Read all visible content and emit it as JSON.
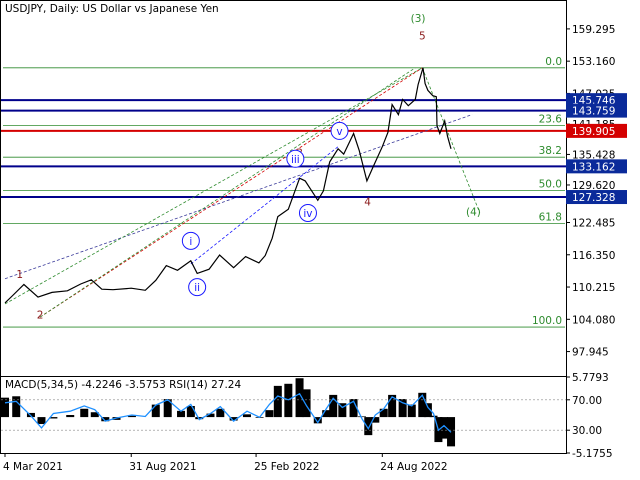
{
  "chart_data": {
    "type": "line",
    "title": "USDJPY, Daily:  US Dollar vs Japanese Yen",
    "colors": {
      "price": "#000000",
      "fib": "#2e8b2e",
      "level_blue": "#00008b",
      "level_red": "#d40000",
      "label_bg_blue": "#0a2a9a",
      "label_bg_red": "#d40000",
      "wave_brown": "#8b1a1a",
      "wave_blue": "#1a1aff",
      "wave_green": "#2e8b2e",
      "grid": "#c8c8c8",
      "macd_hist": "#000000",
      "macd_signal": "#1e90ff",
      "rsi_line": "#1e90ff"
    },
    "price_axis": {
      "ylim": [
        93.3,
        164.6
      ],
      "ticks": [
        "159.295",
        "153.160",
        "147.025",
        "141.185",
        "135.428",
        "129.620",
        "122.485",
        "116.350",
        "110.215",
        "104.080",
        "97.945"
      ]
    },
    "x_axis": {
      "ticks": [
        "4 Mar 2021",
        "31 Aug 2021",
        "25 Feb 2022",
        "24 Aug 2022"
      ],
      "range": [
        "2021-03-04",
        "2022-10-31"
      ]
    },
    "price_series": [
      [
        "2021-03-04",
        107.2
      ],
      [
        "2021-03-15",
        108.6
      ],
      [
        "2021-03-31",
        110.7
      ],
      [
        "2021-04-20",
        108.3
      ],
      [
        "2021-05-10",
        109.2
      ],
      [
        "2021-06-01",
        109.5
      ],
      [
        "2021-06-20",
        110.8
      ],
      [
        "2021-07-05",
        111.6
      ],
      [
        "2021-07-20",
        109.8
      ],
      [
        "2021-08-05",
        109.7
      ],
      [
        "2021-08-31",
        110.0
      ],
      [
        "2021-09-20",
        109.6
      ],
      [
        "2021-10-05",
        111.5
      ],
      [
        "2021-10-20",
        114.3
      ],
      [
        "2021-11-05",
        113.4
      ],
      [
        "2021-11-24",
        115.2
      ],
      [
        "2021-12-03",
        112.8
      ],
      [
        "2021-12-20",
        113.6
      ],
      [
        "2022-01-04",
        116.3
      ],
      [
        "2022-01-24",
        113.9
      ],
      [
        "2022-02-10",
        116.0
      ],
      [
        "2022-03-01",
        114.8
      ],
      [
        "2022-03-10",
        116.2
      ],
      [
        "2022-03-20",
        119.5
      ],
      [
        "2022-03-28",
        123.6
      ],
      [
        "2022-04-12",
        125.0
      ],
      [
        "2022-04-28",
        130.9
      ],
      [
        "2022-05-06",
        130.4
      ],
      [
        "2022-05-24",
        126.7
      ],
      [
        "2022-06-01",
        128.5
      ],
      [
        "2022-06-10",
        134.0
      ],
      [
        "2022-06-22",
        136.5
      ],
      [
        "2022-06-30",
        135.5
      ],
      [
        "2022-07-14",
        139.4
      ],
      [
        "2022-07-22",
        136.2
      ],
      [
        "2022-08-02",
        130.4
      ],
      [
        "2022-08-12",
        133.4
      ],
      [
        "2022-08-24",
        136.9
      ],
      [
        "2022-09-01",
        139.6
      ],
      [
        "2022-09-07",
        144.9
      ],
      [
        "2022-09-16",
        143.0
      ],
      [
        "2022-09-22",
        145.9
      ],
      [
        "2022-09-30",
        144.7
      ],
      [
        "2022-10-10",
        145.9
      ],
      [
        "2022-10-14",
        148.7
      ],
      [
        "2022-10-21",
        151.9
      ],
      [
        "2022-10-24",
        148.9
      ],
      [
        "2022-10-28",
        147.6
      ],
      [
        "2022-11-04",
        146.6
      ],
      [
        "2022-11-09",
        146.4
      ],
      [
        "2022-11-10",
        140.9
      ],
      [
        "2022-11-14",
        139.4
      ],
      [
        "2022-11-21",
        141.8
      ],
      [
        "2022-11-25",
        138.9
      ],
      [
        "2022-11-30",
        136.5
      ]
    ],
    "levels": [
      {
        "value": "145.746",
        "price": 145.746,
        "color": "blue"
      },
      {
        "value": "143.759",
        "price": 143.759,
        "color": "blue"
      },
      {
        "value": "139.905",
        "price": 139.905,
        "color": "red"
      },
      {
        "value": "133.162",
        "price": 133.162,
        "color": "blue"
      },
      {
        "value": "127.328",
        "price": 127.328,
        "color": "blue"
      }
    ],
    "fibonacci": [
      {
        "label": "0.0",
        "price": 151.9
      },
      {
        "label": "23.6",
        "price": 140.9
      },
      {
        "label": "38.2",
        "price": 134.9
      },
      {
        "label": "50.0",
        "price": 128.6
      },
      {
        "label": "61.8",
        "price": 122.3
      },
      {
        "label": "100.0",
        "price": 102.6
      }
    ],
    "wave_labels": [
      {
        "text": "1",
        "date": "2021-03-25",
        "price": 111.9,
        "style": "brown"
      },
      {
        "text": "2",
        "date": "2021-04-23",
        "price": 104.2,
        "style": "brown"
      },
      {
        "text": "3",
        "date": "2022-04-28",
        "price": 135.0,
        "style": "brown"
      },
      {
        "text": "4",
        "date": "2022-08-03",
        "price": 125.7,
        "style": "brown"
      },
      {
        "text": "5",
        "date": "2022-10-20",
        "price": 157.3,
        "style": "brown"
      },
      {
        "text": "(3)",
        "date": "2022-10-14",
        "price": 160.6,
        "style": "green"
      },
      {
        "text": "(4)",
        "date": "2023-01-01",
        "price": 123.8,
        "style": "green"
      },
      {
        "text": "i",
        "date": "2021-11-24",
        "price": 119.0,
        "style": "blue-circle"
      },
      {
        "text": "ii",
        "date": "2021-12-03",
        "price": 110.2,
        "style": "blue-circle"
      },
      {
        "text": "iii",
        "date": "2022-04-22",
        "price": 134.6,
        "style": "blue-circle"
      },
      {
        "text": "iv",
        "date": "2022-05-10",
        "price": 124.3,
        "style": "blue-circle"
      },
      {
        "text": "v",
        "date": "2022-06-24",
        "price": 139.9,
        "style": "blue-circle"
      }
    ],
    "indicator": {
      "label": "MACD(5,34,5) -4.2246 -3.5753 RSI(14) 27.24",
      "right_ticks": [
        "5.7793",
        "70.00",
        "30.00",
        "-5.1755"
      ],
      "macd_hist": [
        [
          "2021-03-04",
          2.8
        ],
        [
          "2021-03-20",
          3.0
        ],
        [
          "2021-04-10",
          0.6
        ],
        [
          "2021-04-25",
          -1.0
        ],
        [
          "2021-05-12",
          -0.2
        ],
        [
          "2021-06-05",
          0.3
        ],
        [
          "2021-06-25",
          1.2
        ],
        [
          "2021-07-10",
          0.7
        ],
        [
          "2021-07-25",
          -0.6
        ],
        [
          "2021-08-10",
          -0.4
        ],
        [
          "2021-09-01",
          0.2
        ],
        [
          "2021-09-20",
          0.0
        ],
        [
          "2021-10-05",
          1.8
        ],
        [
          "2021-10-22",
          2.6
        ],
        [
          "2021-11-10",
          0.9
        ],
        [
          "2021-11-24",
          1.6
        ],
        [
          "2021-12-06",
          -0.3
        ],
        [
          "2021-12-22",
          0.5
        ],
        [
          "2022-01-05",
          1.2
        ],
        [
          "2022-01-24",
          -0.5
        ],
        [
          "2022-02-12",
          0.4
        ],
        [
          "2022-03-02",
          -0.1
        ],
        [
          "2022-03-16",
          1.0
        ],
        [
          "2022-03-28",
          4.5
        ],
        [
          "2022-04-12",
          4.8
        ],
        [
          "2022-04-28",
          5.6
        ],
        [
          "2022-05-08",
          4.0
        ],
        [
          "2022-05-24",
          -0.9
        ],
        [
          "2022-06-05",
          1.0
        ],
        [
          "2022-06-15",
          3.2
        ],
        [
          "2022-06-28",
          2.0
        ],
        [
          "2022-07-14",
          2.6
        ],
        [
          "2022-07-26",
          0.1
        ],
        [
          "2022-08-04",
          -2.6
        ],
        [
          "2022-08-14",
          -0.8
        ],
        [
          "2022-08-26",
          1.2
        ],
        [
          "2022-09-07",
          3.2
        ],
        [
          "2022-09-22",
          2.6
        ],
        [
          "2022-10-05",
          1.8
        ],
        [
          "2022-10-20",
          3.5
        ],
        [
          "2022-10-28",
          2.0
        ],
        [
          "2022-11-05",
          0.2
        ],
        [
          "2022-11-12",
          -3.6
        ],
        [
          "2022-11-20",
          -3.1
        ],
        [
          "2022-11-30",
          -4.22
        ]
      ],
      "rsi": [
        [
          "2021-03-04",
          66
        ],
        [
          "2021-03-20",
          68
        ],
        [
          "2021-04-10",
          49
        ],
        [
          "2021-04-25",
          33
        ],
        [
          "2021-05-12",
          52
        ],
        [
          "2021-06-05",
          55
        ],
        [
          "2021-06-25",
          62
        ],
        [
          "2021-07-10",
          57
        ],
        [
          "2021-07-25",
          42
        ],
        [
          "2021-08-10",
          46
        ],
        [
          "2021-09-01",
          50
        ],
        [
          "2021-09-20",
          48
        ],
        [
          "2021-10-05",
          63
        ],
        [
          "2021-10-22",
          70
        ],
        [
          "2021-11-10",
          55
        ],
        [
          "2021-11-24",
          64
        ],
        [
          "2021-12-06",
          44
        ],
        [
          "2021-12-22",
          52
        ],
        [
          "2022-01-05",
          61
        ],
        [
          "2022-01-24",
          42
        ],
        [
          "2022-02-12",
          55
        ],
        [
          "2022-03-02",
          47
        ],
        [
          "2022-03-16",
          64
        ],
        [
          "2022-03-28",
          75
        ],
        [
          "2022-04-12",
          70
        ],
        [
          "2022-04-28",
          78
        ],
        [
          "2022-05-08",
          62
        ],
        [
          "2022-05-24",
          40
        ],
        [
          "2022-06-05",
          58
        ],
        [
          "2022-06-15",
          72
        ],
        [
          "2022-06-28",
          60
        ],
        [
          "2022-07-14",
          68
        ],
        [
          "2022-07-26",
          45
        ],
        [
          "2022-08-04",
          32
        ],
        [
          "2022-08-14",
          50
        ],
        [
          "2022-08-26",
          58
        ],
        [
          "2022-09-07",
          74
        ],
        [
          "2022-09-22",
          66
        ],
        [
          "2022-10-05",
          62
        ],
        [
          "2022-10-20",
          76
        ],
        [
          "2022-10-28",
          60
        ],
        [
          "2022-11-05",
          52
        ],
        [
          "2022-11-12",
          30
        ],
        [
          "2022-11-20",
          36
        ],
        [
          "2022-11-30",
          27.24
        ]
      ]
    }
  }
}
